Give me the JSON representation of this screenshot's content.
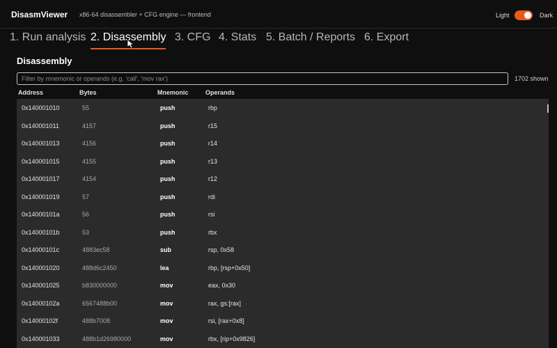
{
  "header": {
    "app_title": "DisasmViewer",
    "subtitle": "x86-64 disassembler + CFG engine — frontend",
    "theme": {
      "light_label": "Light",
      "dark_label": "Dark",
      "accent": "#e85a1b"
    }
  },
  "tabs": [
    {
      "label": "1. Run analysis",
      "active": false
    },
    {
      "label": "2. Disassembly",
      "active": true
    },
    {
      "label": "3. CFG",
      "active": false
    },
    {
      "label": "4. Stats",
      "active": false
    },
    {
      "label": "5. Batch / Reports",
      "active": false
    },
    {
      "label": "6. Export",
      "active": false
    }
  ],
  "section": {
    "title": "Disassembly",
    "filter": {
      "placeholder": "Filter by mnemonic or operands (e.g. 'call', 'mov rax')",
      "value": ""
    },
    "shown_count": "1702 shown"
  },
  "table": {
    "columns": [
      "Address",
      "Bytes",
      "Mnemonic",
      "Operands"
    ],
    "rows": [
      {
        "address": "0x140001010",
        "bytes": "55",
        "mnemonic": "push",
        "operands": "rbp"
      },
      {
        "address": "0x140001011",
        "bytes": "4157",
        "mnemonic": "push",
        "operands": "r15"
      },
      {
        "address": "0x140001013",
        "bytes": "4156",
        "mnemonic": "push",
        "operands": "r14"
      },
      {
        "address": "0x140001015",
        "bytes": "4155",
        "mnemonic": "push",
        "operands": "r13"
      },
      {
        "address": "0x140001017",
        "bytes": "4154",
        "mnemonic": "push",
        "operands": "r12"
      },
      {
        "address": "0x140001019",
        "bytes": "57",
        "mnemonic": "push",
        "operands": "rdi"
      },
      {
        "address": "0x14000101a",
        "bytes": "56",
        "mnemonic": "push",
        "operands": "rsi"
      },
      {
        "address": "0x14000101b",
        "bytes": "53",
        "mnemonic": "push",
        "operands": "rbx"
      },
      {
        "address": "0x14000101c",
        "bytes": "4883ec58",
        "mnemonic": "sub",
        "operands": "rsp, 0x58"
      },
      {
        "address": "0x140001020",
        "bytes": "488d6c2450",
        "mnemonic": "lea",
        "operands": "rbp, [rsp+0x50]"
      },
      {
        "address": "0x140001025",
        "bytes": "b830000000",
        "mnemonic": "mov",
        "operands": "eax, 0x30"
      },
      {
        "address": "0x14000102a",
        "bytes": "6567488b00",
        "mnemonic": "mov",
        "operands": "rax, gs:[rax]"
      },
      {
        "address": "0x14000102f",
        "bytes": "488b7008",
        "mnemonic": "mov",
        "operands": "rsi, [rax+0x8]"
      },
      {
        "address": "0x140001033",
        "bytes": "488b1d26980000",
        "mnemonic": "mov",
        "operands": "rbx, [rip+0x9826]"
      }
    ]
  }
}
